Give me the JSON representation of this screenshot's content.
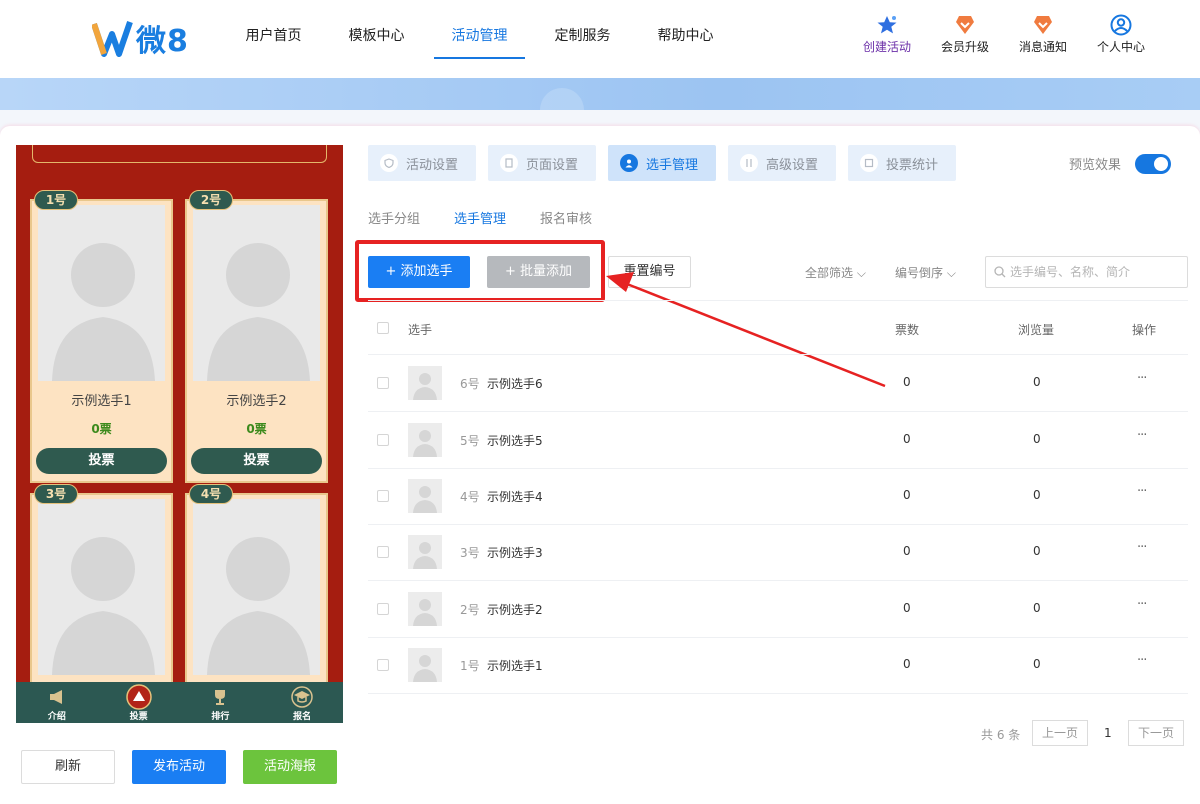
{
  "header": {
    "logo_text": "微8",
    "nav": [
      "用户首页",
      "模板中心",
      "活动管理",
      "定制服务",
      "帮助中心"
    ],
    "active_nav": "活动管理",
    "tools": [
      {
        "label": "创建活动",
        "icon": "star-icon",
        "color": "#6b2fa8"
      },
      {
        "label": "会员升级",
        "icon": "vip-badge-icon",
        "color": "#f07b3f"
      },
      {
        "label": "消息通知",
        "icon": "notify-badge-icon",
        "color": "#f07b3f"
      },
      {
        "label": "个人中心",
        "icon": "user-icon",
        "color": "#1677e0"
      }
    ]
  },
  "preview": {
    "contestants": [
      {
        "badge": "1号",
        "name": "示例选手1",
        "votes": "0票",
        "vote_btn": "投票"
      },
      {
        "badge": "2号",
        "name": "示例选手2",
        "votes": "0票",
        "vote_btn": "投票"
      },
      {
        "badge": "3号"
      },
      {
        "badge": "4号"
      }
    ],
    "bottom_nav": [
      "介绍",
      "投票",
      "排行",
      "报名"
    ]
  },
  "bottom_buttons": {
    "refresh": "刷新",
    "publish": "发布活动",
    "poster": "活动海报"
  },
  "steps": [
    "活动设置",
    "页面设置",
    "选手管理",
    "高级设置",
    "投票统计"
  ],
  "active_step": "选手管理",
  "preview_toggle": {
    "label": "预览效果",
    "on": true
  },
  "subtabs": [
    "选手分组",
    "选手管理",
    "报名审核"
  ],
  "active_subtab": "选手管理",
  "actions": {
    "add": "+ 添加选手",
    "batch": "+ 批量添加",
    "reset": "重置编号"
  },
  "filters": {
    "all": "全部筛选",
    "sort": "编号倒序"
  },
  "search": {
    "placeholder": "选手编号、名称、简介"
  },
  "table": {
    "headers": {
      "player": "选手",
      "votes": "票数",
      "views": "浏览量",
      "ops": "操作"
    },
    "rows": [
      {
        "num": "6号",
        "name": "示例选手6",
        "votes": "0",
        "views": "0",
        "more": "···"
      },
      {
        "num": "5号",
        "name": "示例选手5",
        "votes": "0",
        "views": "0",
        "more": "···"
      },
      {
        "num": "4号",
        "name": "示例选手4",
        "votes": "0",
        "views": "0",
        "more": "···"
      },
      {
        "num": "3号",
        "name": "示例选手3",
        "votes": "0",
        "views": "0",
        "more": "···"
      },
      {
        "num": "2号",
        "name": "示例选手2",
        "votes": "0",
        "views": "0",
        "more": "···"
      },
      {
        "num": "1号",
        "name": "示例选手1",
        "votes": "0",
        "views": "0",
        "more": "···"
      }
    ]
  },
  "pagination": {
    "total": "共 6 条",
    "prev": "上一页",
    "page": "1",
    "next": "下一页"
  },
  "colors": {
    "primary": "#1677e0",
    "highlight": "#e62222",
    "preview_bg": "#a51d10",
    "preview_accent": "#2f5a4f"
  }
}
